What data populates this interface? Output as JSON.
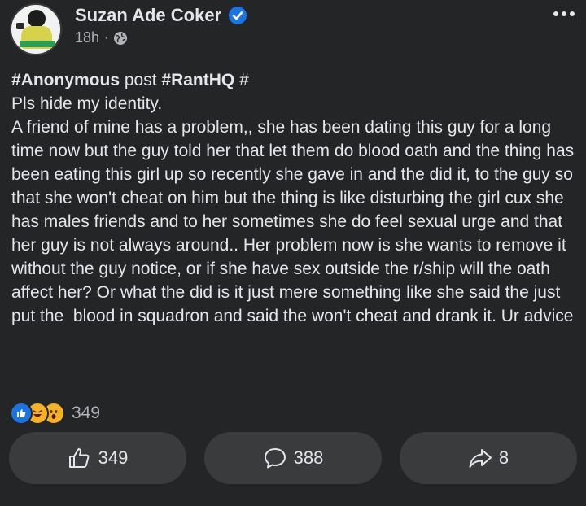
{
  "post": {
    "author": "Suzan Ade Coker",
    "time": "18h",
    "separator": "·",
    "title_hashtag1": "#Anonymous",
    "title_mid": " post ",
    "title_hashtag2": "#RantHQ",
    "title_end": " #",
    "body": "Pls hide my identity.\nA friend of mine has a problem,, she has been dating this guy for a long time now but the guy told her that let them do blood oath and the thing has been eating this girl up so recently she gave in and the did it, to the guy so that she won't cheat on him but the thing is like disturbing the girl cux she has males friends and to her sometimes she do feel sexual urge and that her guy is not always around.. Her problem now is she wants to remove it without the guy notice, or if she have sex outside the r/ship will the oath affect her? Or what the did is it just mere something like she said the just put the  blood in squadron and said the won't cheat and drank it. Ur advice"
  },
  "reactions": {
    "types": [
      "like",
      "haha",
      "wow"
    ],
    "count": "349"
  },
  "actions": {
    "like_count": "349",
    "comment_count": "388",
    "share_count": "8"
  },
  "colors": {
    "background": "#242526",
    "button": "#3a3b3c",
    "text": "#e4e6eb",
    "muted": "#b0b3b8",
    "accent": "#1b74e4"
  }
}
